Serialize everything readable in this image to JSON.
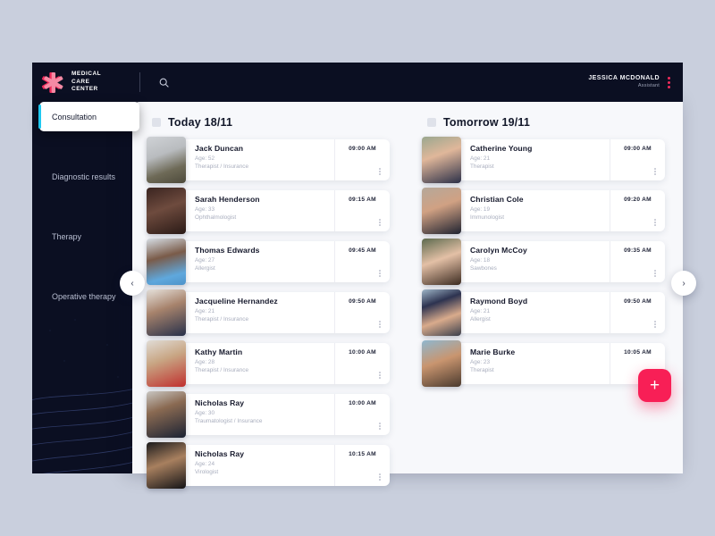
{
  "brand": {
    "line1": "MEDICAL",
    "line2": "CARE",
    "line3": "CENTER",
    "logo_icon": "asterisk-medical-logo-icon",
    "logo_color": "#ef2b5b"
  },
  "topbar": {
    "search_icon": "search-icon",
    "user_name": "JESSICA MCDONALD",
    "user_role": "Assistant",
    "user_menu_icon": "kebab-menu-icon"
  },
  "sidebar": {
    "items": [
      {
        "label": "Consultation",
        "active": true
      },
      {
        "label": "Diagnostic results",
        "active": false
      },
      {
        "label": "Therapy",
        "active": false
      },
      {
        "label": "Operative therapy",
        "active": false
      }
    ],
    "active_accent": "#1ec8f0"
  },
  "nav": {
    "prev_icon": "chevron-left-icon",
    "prev_label": "‹",
    "next_icon": "chevron-right-icon",
    "next_label": "›"
  },
  "fab": {
    "label": "+",
    "icon": "plus-icon",
    "color": "#f81f56"
  },
  "columns": [
    {
      "title": "Today  18/11",
      "appointments": [
        {
          "name": "Jack Duncan",
          "age": "Age: 52",
          "specialty": "Therapist / Insurance",
          "time": "09:00 AM",
          "avatar_bg": "linear-gradient(160deg,#cfd2d6 0%,#b9bcbf 38%,#6e6a57 70%,#4d4a3b 100%)"
        },
        {
          "name": "Sarah Henderson",
          "age": "Age: 33",
          "specialty": "Ophthalmologist",
          "time": "09:15 AM",
          "avatar_bg": "linear-gradient(160deg,#3a2420 0%,#6e4b3e 45%,#2a1a16 100%)"
        },
        {
          "name": "Thomas Edwards",
          "age": "Age: 27",
          "specialty": "Allergist",
          "time": "09:45 AM",
          "avatar_bg": "linear-gradient(165deg,#d6dde4 0%,#7a5b49 40%,#5fa8dd 78%,#4e93c9 100%)"
        },
        {
          "name": "Jacqueline Hernandez",
          "age": "Age: 21",
          "specialty": "Therapist / Insurance",
          "time": "09:50 AM",
          "avatar_bg": "linear-gradient(160deg,#e7e3dd 0%,#a7836c 42%,#27304a 100%)"
        },
        {
          "name": "Kathy Martin",
          "age": "Age: 28",
          "specialty": "Therapist / Insurance",
          "time": "10:00 AM",
          "avatar_bg": "linear-gradient(160deg,#e0dcd6 0%,#c8a583 42%,#c0302e 100%)"
        },
        {
          "name": "Nicholas Ray",
          "age": "Age: 30",
          "specialty": "Traumatologist / Insurance",
          "time": "10:00 AM",
          "avatar_bg": "linear-gradient(160deg,#c8c6c2 0%,#8a6a52 38%,#1b2233 100%)"
        },
        {
          "name": "Nicholas Ray",
          "age": "Age: 24",
          "specialty": "Virologist",
          "time": "10:15 AM",
          "avatar_bg": "linear-gradient(160deg,#1a1a1c 0%,#a8805f 45%,#141416 100%)"
        }
      ]
    },
    {
      "title": "Tomorrow  19/11",
      "appointments": [
        {
          "name": "Catherine Young",
          "age": "Age: 21",
          "specialty": "Therapist",
          "time": "09:00 AM",
          "avatar_bg": "linear-gradient(160deg,#9aa78f 0%,#e0b79a 40%,#2b3048 100%)"
        },
        {
          "name": "Christian Cole",
          "age": "Age: 19",
          "specialty": "Immunologist",
          "time": "09:20 AM",
          "avatar_bg": "linear-gradient(160deg,#b5a89a 0%,#d0a183 42%,#1e2230 100%)"
        },
        {
          "name": "Carolyn McCoy",
          "age": "Age: 18",
          "specialty": "Sawbones",
          "time": "09:35 AM",
          "avatar_bg": "linear-gradient(160deg,#5c6a4e 0%,#e3c0a6 45%,#3b2a20 100%)"
        },
        {
          "name": "Raymond Boyd",
          "age": "Age: 21",
          "specialty": "Allergist",
          "time": "09:50 AM",
          "avatar_bg": "linear-gradient(160deg,#9fb6c8 0%,#2d3350 30%,#d9ab8c 62%,#3a3f4c 100%)"
        },
        {
          "name": "Marie Burke",
          "age": "Age: 23",
          "specialty": "Therapist",
          "time": "10:05 AM",
          "avatar_bg": "linear-gradient(160deg,#8fb7cf 0%,#c9956f 45%,#4a3a2e 100%)"
        }
      ]
    }
  ]
}
